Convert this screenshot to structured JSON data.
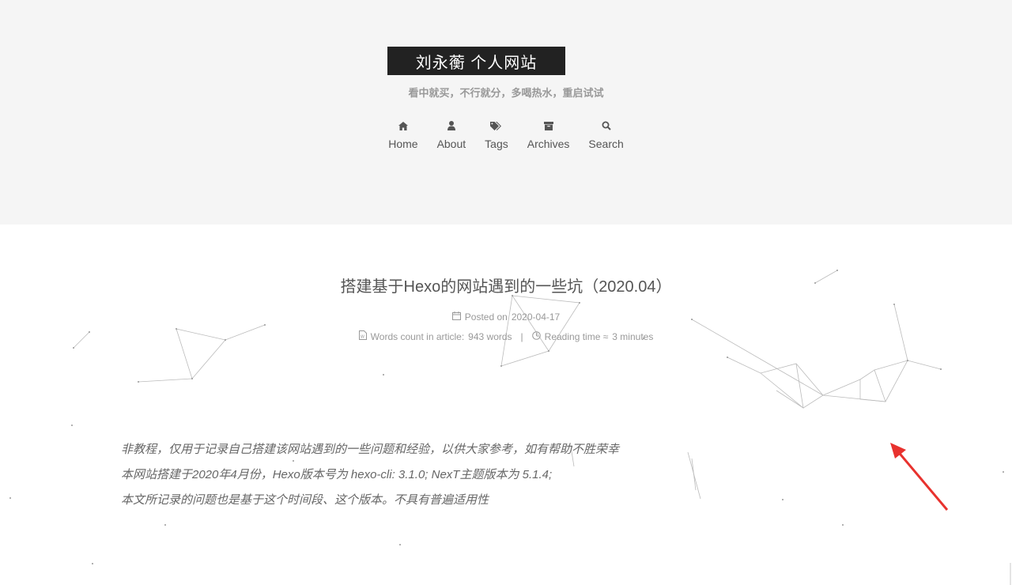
{
  "site": {
    "title": "刘永蘅 个人网站",
    "subtitle": "看中就买，不行就分，多喝热水，重启试试"
  },
  "nav": {
    "items": [
      {
        "label": "Home",
        "icon": "home-icon"
      },
      {
        "label": "About",
        "icon": "user-icon"
      },
      {
        "label": "Tags",
        "icon": "tags-icon"
      },
      {
        "label": "Archives",
        "icon": "archive-icon"
      },
      {
        "label": "Search",
        "icon": "search-icon"
      }
    ]
  },
  "post": {
    "title": "搭建基于Hexo的网站遇到的一些坑（2020.04）",
    "posted_on_label": "Posted on",
    "posted_on_date": "2020-04-17",
    "words_label": "Words count in article:",
    "words_value": "943 words",
    "separator": "|",
    "reading_label": "Reading time ≈",
    "reading_value": "3 minutes",
    "excerpt": [
      "非教程，仅用于记录自己搭建该网站遇到的一些问题和经验，以供大家参考，如有帮助不胜荣幸",
      "本网站搭建于2020年4月份，Hexo版本号为 hexo-cli: 3.1.0; NexT主题版本为 5.1.4;",
      "本文所记录的问题也是基于这个时间段、这个版本。不具有普遍适用性"
    ]
  },
  "colors": {
    "header_bg": "#f5f5f5",
    "title_bg": "#222222",
    "arrow": "#e8322e"
  }
}
